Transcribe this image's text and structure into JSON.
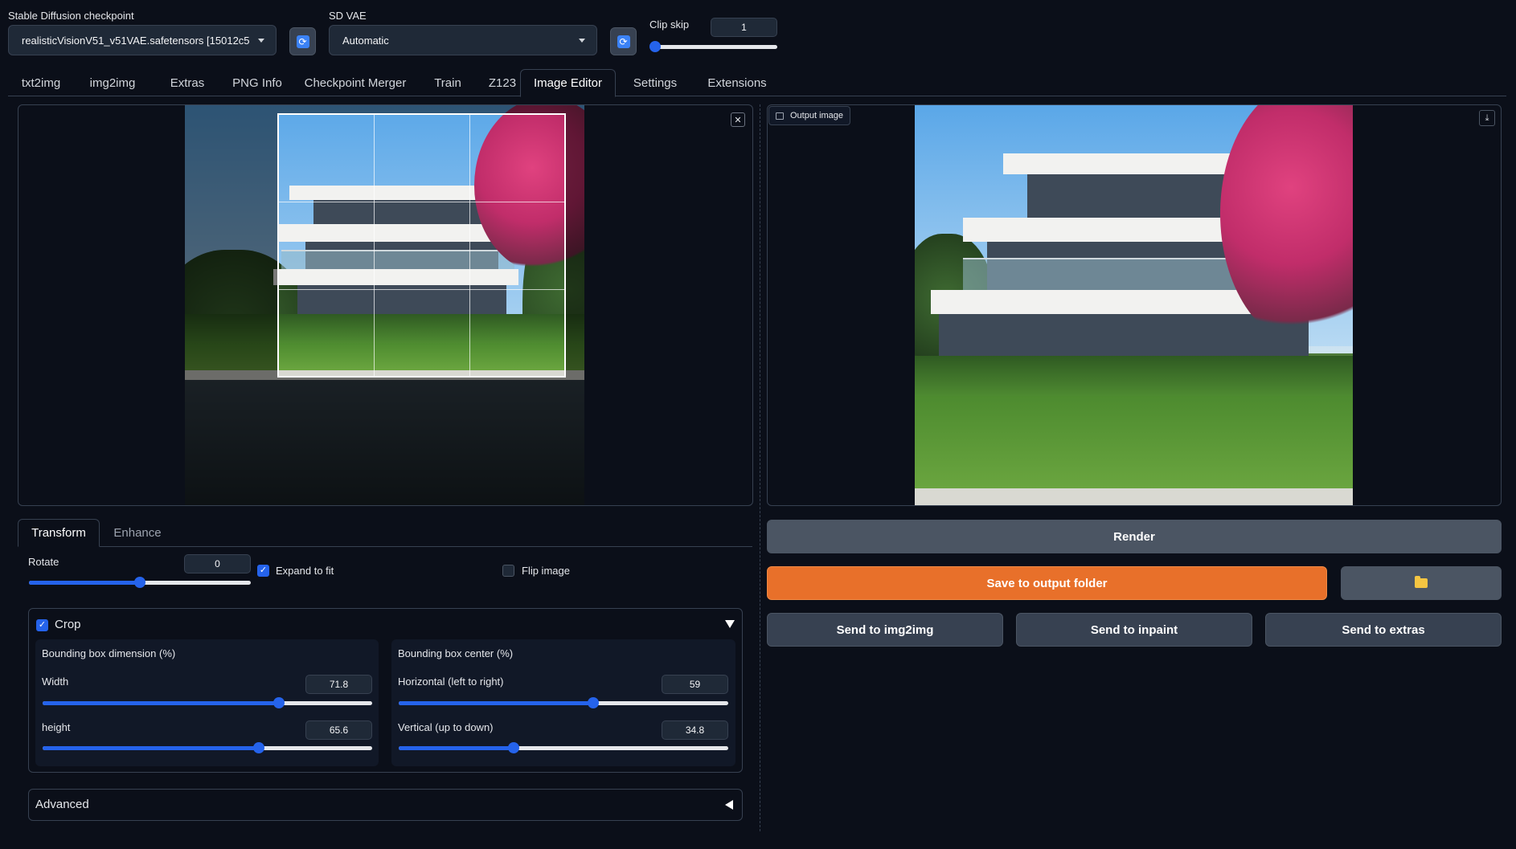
{
  "top": {
    "checkpoint_label": "Stable Diffusion checkpoint",
    "checkpoint_value": "realisticVisionV51_v51VAE.safetensors [15012c5",
    "vae_label": "SD VAE",
    "vae_value": "Automatic",
    "clip_skip_label": "Clip skip",
    "clip_skip_value": "1",
    "clip_skip_fraction": 0.0
  },
  "tabs": [
    {
      "label": "txt2img"
    },
    {
      "label": "img2img"
    },
    {
      "label": "Extras"
    },
    {
      "label": "PNG Info"
    },
    {
      "label": "Checkpoint Merger"
    },
    {
      "label": "Train"
    },
    {
      "label": "Z123"
    },
    {
      "label": "Image Editor"
    },
    {
      "label": "Settings"
    },
    {
      "label": "Extensions"
    }
  ],
  "active_tab": "Image Editor",
  "editor": {
    "output_label": "Output image",
    "close_glyph": "✕",
    "download_glyph": "⤓"
  },
  "subtabs": [
    {
      "label": "Transform"
    },
    {
      "label": "Enhance"
    }
  ],
  "transform": {
    "rotate_label": "Rotate",
    "rotate_value": "0",
    "rotate_fraction": 0.5,
    "expand_label": "Expand to fit",
    "expand_checked": true,
    "flip_label": "Flip image",
    "flip_checked": false
  },
  "crop": {
    "label": "Crop",
    "checked": true,
    "dimension_title": "Bounding box dimension (%)",
    "center_title": "Bounding box center (%)",
    "width_label": "Width",
    "width_value": "71.8",
    "width_fraction": 0.718,
    "height_label": "height",
    "height_value": "65.6",
    "height_fraction": 0.656,
    "horizontal_label": "Horizontal (left to right)",
    "horizontal_value": "59",
    "horizontal_fraction": 0.59,
    "vertical_label": "Vertical (up to down)",
    "vertical_value": "34.8",
    "vertical_fraction": 0.348
  },
  "advanced_label": "Advanced",
  "actions": {
    "render": "Render",
    "save": "Save to output folder",
    "send_img2img": "Send to img2img",
    "send_inpaint": "Send to inpaint",
    "send_extras": "Send to extras"
  },
  "icons": {
    "refresh": "refresh-icon",
    "folder": "folder-icon",
    "close": "close-icon",
    "download": "download-icon",
    "image": "image-icon"
  },
  "colors": {
    "background": "#0b0f19",
    "accent": "#2563eb",
    "primary_button": "#e8702a",
    "secondary_button": "#4b5563"
  }
}
